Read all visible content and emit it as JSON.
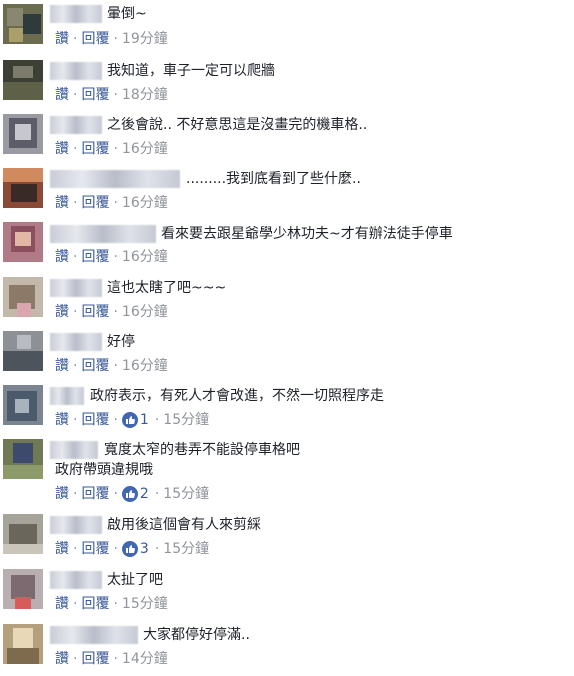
{
  "comments": [
    {
      "text": "暈倒~",
      "like": "讚",
      "reply": "回覆",
      "reactions": "",
      "time": "19分鐘"
    },
    {
      "text": "我知道，車子一定可以爬牆",
      "like": "讚",
      "reply": "回覆",
      "reactions": "",
      "time": "18分鐘"
    },
    {
      "text": "之後會說.. 不好意思這是沒畫完的機車格..",
      "like": "讚",
      "reply": "回覆",
      "reactions": "",
      "time": "16分鐘"
    },
    {
      "text": ".........我到底看到了些什麼..",
      "like": "讚",
      "reply": "回覆",
      "reactions": "",
      "time": "16分鐘"
    },
    {
      "text": "看來要去跟星爺學少林功夫~才有辦法徒手停車",
      "like": "讚",
      "reply": "回覆",
      "reactions": "",
      "time": "16分鐘"
    },
    {
      "text": "這也太瞎了吧~~~",
      "like": "讚",
      "reply": "回覆",
      "reactions": "",
      "time": "16分鐘"
    },
    {
      "text": "好停",
      "like": "讚",
      "reply": "回覆",
      "reactions": "",
      "time": "16分鐘"
    },
    {
      "text": "政府表示，有死人才會改進，不然一切照程序走",
      "like": "讚",
      "reply": "回覆",
      "reactions": "1",
      "time": "15分鐘"
    },
    {
      "text": "寬度太窄的巷弄不能設停車格吧",
      "text2": "政府帶頭違規哦",
      "like": "讚",
      "reply": "回覆",
      "reactions": "2",
      "time": "15分鐘"
    },
    {
      "text": "啟用後這個會有人來剪綵",
      "like": "讚",
      "reply": "回覆",
      "reactions": "3",
      "time": "15分鐘"
    },
    {
      "text": "太扯了吧",
      "like": "讚",
      "reply": "回覆",
      "reactions": "",
      "time": "15分鐘"
    },
    {
      "text": "大家都停好停滿..",
      "like": "讚",
      "reply": "回覆",
      "reactions": "",
      "time": "14分鐘"
    }
  ],
  "colors": {
    "link": "#385898",
    "meta": "#90949c",
    "text": "#1d2129",
    "like_icon": "#4267b2"
  },
  "icons": {
    "reaction": "like-thumb-icon"
  }
}
